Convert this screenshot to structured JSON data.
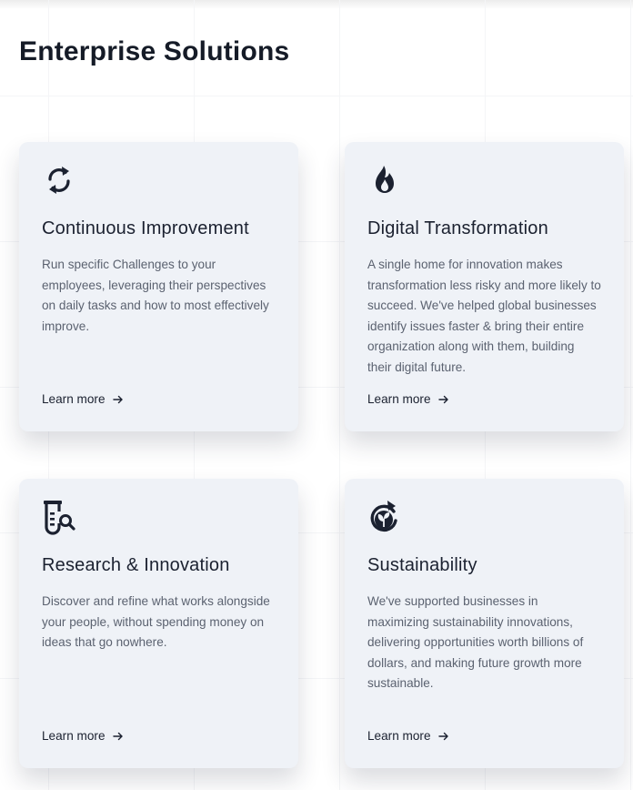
{
  "page": {
    "title": "Enterprise Solutions"
  },
  "colors": {
    "card_background": "#eff2f7",
    "heading": "#151b27",
    "body_text": "#5b6270"
  },
  "cards": [
    {
      "icon": "refresh-arrows-icon",
      "title": "Continuous Improvement",
      "description": "Run specific Challenges to your employees, leveraging their perspectives on daily tasks and how to most effectively improve.",
      "link_label": "Learn more"
    },
    {
      "icon": "flame-icon",
      "title": "Digital Transformation",
      "description": "A single home for innovation makes transformation less risky and more likely to succeed. We've helped global businesses identify issues faster & bring their entire organization along with them, building their digital future.",
      "link_label": "Learn more"
    },
    {
      "icon": "test-tube-search-icon",
      "title": "Research & Innovation",
      "description": "Discover and refine what works alongside your people, without spending money on ideas that go nowhere.",
      "link_label": "Learn more"
    },
    {
      "icon": "recycle-leaf-icon",
      "title": "Sustainability",
      "description": "We've supported businesses in maximizing sustainability innovations, delivering opportunities worth billions of dollars, and making future growth more sustainable.",
      "link_label": "Learn more"
    }
  ]
}
